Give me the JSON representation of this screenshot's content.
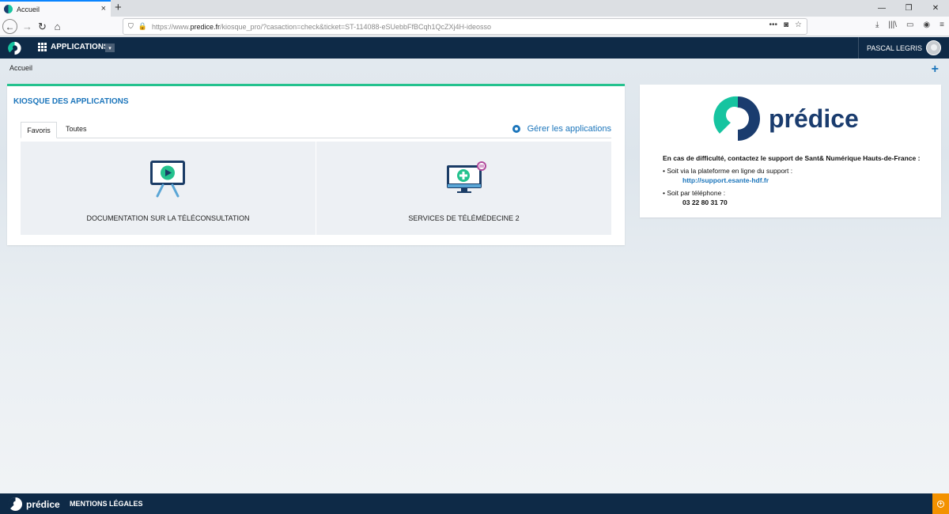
{
  "browser": {
    "tab_title": "Accueil",
    "tab_close": "×",
    "new_tab": "+",
    "url_prefix": "https://www.",
    "url_domain": "predice.fr",
    "url_path": "/kiosque_pro/?casaction=check&ticket=ST-114088-eSUebbFfBCqh1QcZXj4H-ideosso",
    "url_actions": "•••",
    "window_controls": [
      "—",
      "❐",
      "✕"
    ]
  },
  "header": {
    "apps_label": "APPLICATIONS",
    "user_name": "PASCAL LEGRIS"
  },
  "breadcrumb": "Accueil",
  "kiosk": {
    "title": "KIOSQUE DES APPLICATIONS",
    "tabs": [
      "Favoris",
      "Toutes"
    ],
    "manage_label": "Gérer les applications",
    "help_badge": "?",
    "cards": [
      {
        "label": "DOCUMENTATION SUR LA TÉLÉCONSULTATION",
        "icon": "video-presentation-icon"
      },
      {
        "label": "SERVICES DE TÉLÉMÉDECINE 2",
        "icon": "telemedicine-monitor-icon"
      }
    ]
  },
  "support": {
    "brand": "prédice",
    "lead": "En cas de difficulté, contactez le support de Sant& Numérique Hauts-de-France :",
    "platform_line": "• Soit via la plateforme en ligne du support :",
    "platform_link": "http://support.esante-hdf.fr",
    "phone_line": "• Soit par téléphone :",
    "phone": "03 22 80 31 70"
  },
  "footer": {
    "brand": "prédice",
    "legal": "MENTIONS LÉGALES"
  },
  "colors": {
    "navy": "#0e2a47",
    "accent_blue": "#1b75bb",
    "accent_green": "#25c28e",
    "orange": "#f39200"
  }
}
